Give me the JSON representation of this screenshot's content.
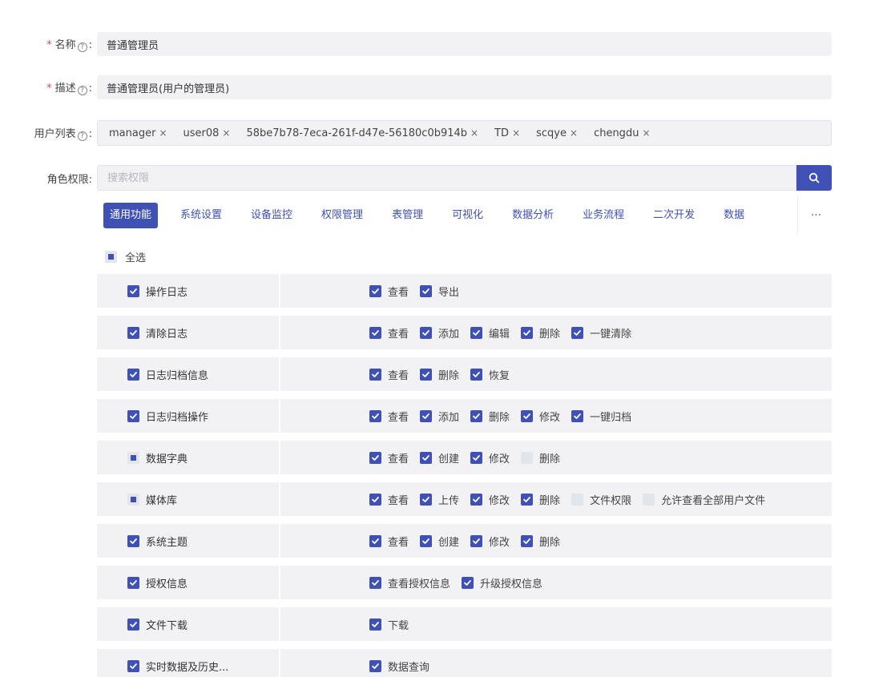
{
  "form": {
    "name_label": "名称",
    "name_value": "普通管理员",
    "desc_label": "描述",
    "desc_value": "普通管理员(用户的管理员)",
    "users_label": "用户列表",
    "users": [
      "manager",
      "user08",
      "58be7b78-7eca-261f-d47e-56180c0b914b",
      "TD",
      "scqye",
      "chengdu"
    ],
    "perm_label": "角色权限",
    "required_mark": "*",
    "help_glyph": "?",
    "colon": ":"
  },
  "search": {
    "placeholder": "搜索权限"
  },
  "tabs": [
    "通用功能",
    "系统设置",
    "设备监控",
    "权限管理",
    "表管理",
    "可视化",
    "数据分析",
    "业务流程",
    "二次开发",
    "数据"
  ],
  "more_label": "···",
  "select_all": {
    "label": "全选",
    "state": "indeterminate"
  },
  "permissions": [
    {
      "name": "操作日志",
      "state": "checked",
      "options": [
        {
          "label": "查看",
          "checked": true
        },
        {
          "label": "导出",
          "checked": true
        }
      ]
    },
    {
      "name": "清除日志",
      "state": "checked",
      "options": [
        {
          "label": "查看",
          "checked": true
        },
        {
          "label": "添加",
          "checked": true
        },
        {
          "label": "编辑",
          "checked": true
        },
        {
          "label": "删除",
          "checked": true
        },
        {
          "label": "一键清除",
          "checked": true
        }
      ]
    },
    {
      "name": "日志归档信息",
      "state": "checked",
      "options": [
        {
          "label": "查看",
          "checked": true
        },
        {
          "label": "删除",
          "checked": true
        },
        {
          "label": "恢复",
          "checked": true
        }
      ]
    },
    {
      "name": "日志归档操作",
      "state": "checked",
      "options": [
        {
          "label": "查看",
          "checked": true
        },
        {
          "label": "添加",
          "checked": true
        },
        {
          "label": "删除",
          "checked": true
        },
        {
          "label": "修改",
          "checked": true
        },
        {
          "label": "一键归档",
          "checked": true
        }
      ]
    },
    {
      "name": "数据字典",
      "state": "indeterminate",
      "options": [
        {
          "label": "查看",
          "checked": true
        },
        {
          "label": "创建",
          "checked": true
        },
        {
          "label": "修改",
          "checked": true
        },
        {
          "label": "删除",
          "checked": false
        }
      ]
    },
    {
      "name": "媒体库",
      "state": "indeterminate",
      "options": [
        {
          "label": "查看",
          "checked": true
        },
        {
          "label": "上传",
          "checked": true
        },
        {
          "label": "修改",
          "checked": true
        },
        {
          "label": "删除",
          "checked": true
        },
        {
          "label": "文件权限",
          "checked": false
        },
        {
          "label": "允许查看全部用户文件",
          "checked": false
        }
      ]
    },
    {
      "name": "系统主题",
      "state": "checked",
      "options": [
        {
          "label": "查看",
          "checked": true
        },
        {
          "label": "创建",
          "checked": true
        },
        {
          "label": "修改",
          "checked": true
        },
        {
          "label": "删除",
          "checked": true
        }
      ]
    },
    {
      "name": "授权信息",
      "state": "checked",
      "options": [
        {
          "label": "查看授权信息",
          "checked": true
        },
        {
          "label": "升级授权信息",
          "checked": true
        }
      ]
    },
    {
      "name": "文件下载",
      "state": "checked",
      "options": [
        {
          "label": "下载",
          "checked": true
        }
      ]
    },
    {
      "name": "实时数据及历史...",
      "state": "checked",
      "options": [
        {
          "label": "数据查询",
          "checked": true
        }
      ]
    }
  ],
  "colors": {
    "accent": "#3f51b5",
    "field_bg": "#f2f2f4",
    "required": "#e5484d"
  }
}
